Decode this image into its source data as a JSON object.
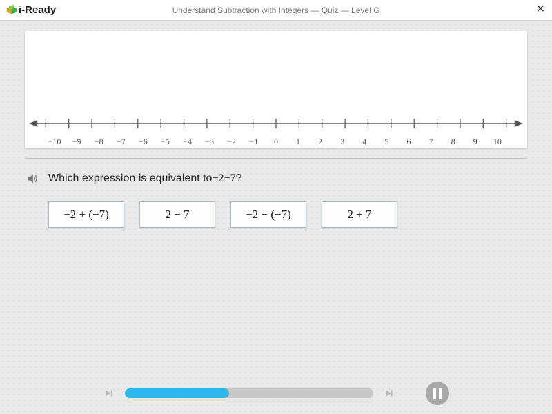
{
  "header": {
    "brand": "i-Ready",
    "lesson_title": "Understand Subtraction with Integers — Quiz — Level G",
    "close_label": "✕"
  },
  "number_line": {
    "min": -10,
    "max": 10,
    "ticks": [
      "−10",
      "−9",
      "−8",
      "−7",
      "−6",
      "−5",
      "−4",
      "−3",
      "−2",
      "−1",
      "0",
      "1",
      "2",
      "3",
      "4",
      "5",
      "6",
      "7",
      "8",
      "9",
      "10"
    ]
  },
  "question": {
    "prompt_prefix": "Which expression is equivalent to",
    "prompt_expr": "−2−7",
    "prompt_suffix": "?"
  },
  "answers": {
    "a": "−2 + (−7)",
    "b": "2 − 7",
    "c": "−2 − (−7)",
    "d": "2 + 7"
  },
  "progress": {
    "percent": 42
  }
}
